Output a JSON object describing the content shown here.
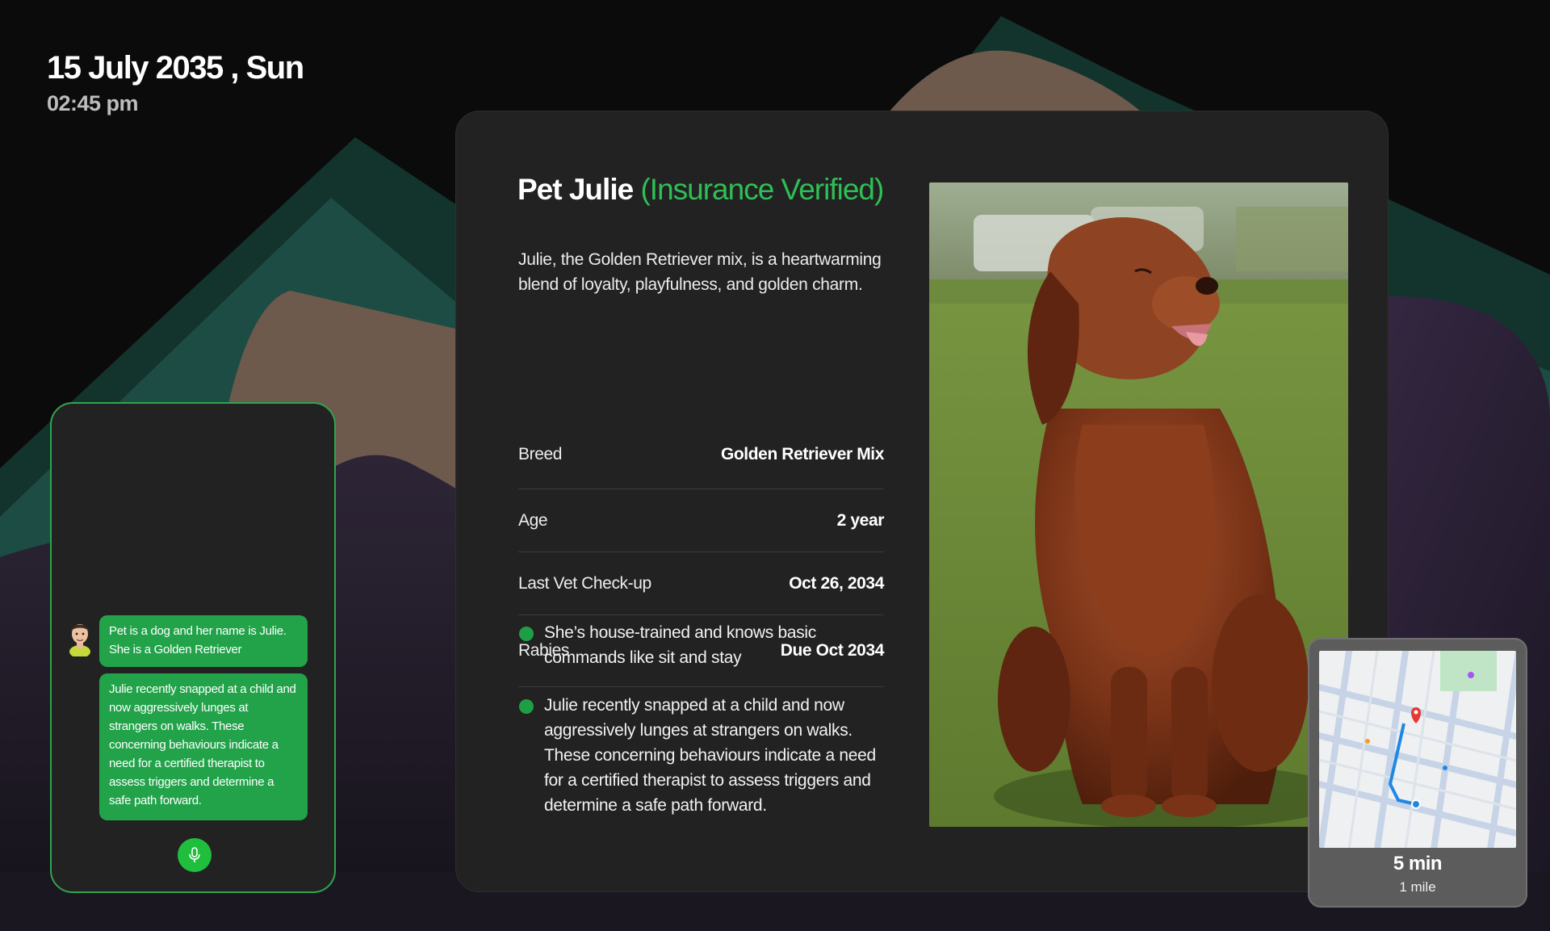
{
  "clock": {
    "date": "15 July 2035 , Sun",
    "time": "02:45 pm"
  },
  "chat": {
    "messages": [
      "Pet is a dog and her name is Julie. She is a Golden Retriever",
      "Julie recently snapped at a child and now aggressively lunges at strangers on walks. These concerning behaviours indicate a need for a certified therapist to assess triggers and determine a safe path forward."
    ],
    "mic_icon": "microphone-icon"
  },
  "pet": {
    "name": "Pet Julie",
    "status": "(Insurance Verified)",
    "description": "Julie, the Golden Retriever mix, is a heartwarming blend of loyalty, playfulness, and golden charm.",
    "specs": [
      {
        "label": "Breed",
        "value": "Golden Retriever Mix"
      },
      {
        "label": "Age",
        "value": "2 year"
      },
      {
        "label": "Last Vet Check-up",
        "value": "Oct 26, 2034"
      },
      {
        "label": "Rabies",
        "value": "Due Oct 2034"
      }
    ],
    "notes": [
      "She’s house-trained and knows basic commands like sit and stay",
      "Julie recently snapped at a child and now aggressively lunges at strangers on walks. These concerning behaviours indicate a need for a certified therapist to assess triggers and determine a safe path forward."
    ]
  },
  "map": {
    "eta": "5 min",
    "distance": "1 mile"
  },
  "colors": {
    "accent_green": "#22a34a",
    "verified_green": "#2fbf55",
    "card_bg": "#222223"
  }
}
